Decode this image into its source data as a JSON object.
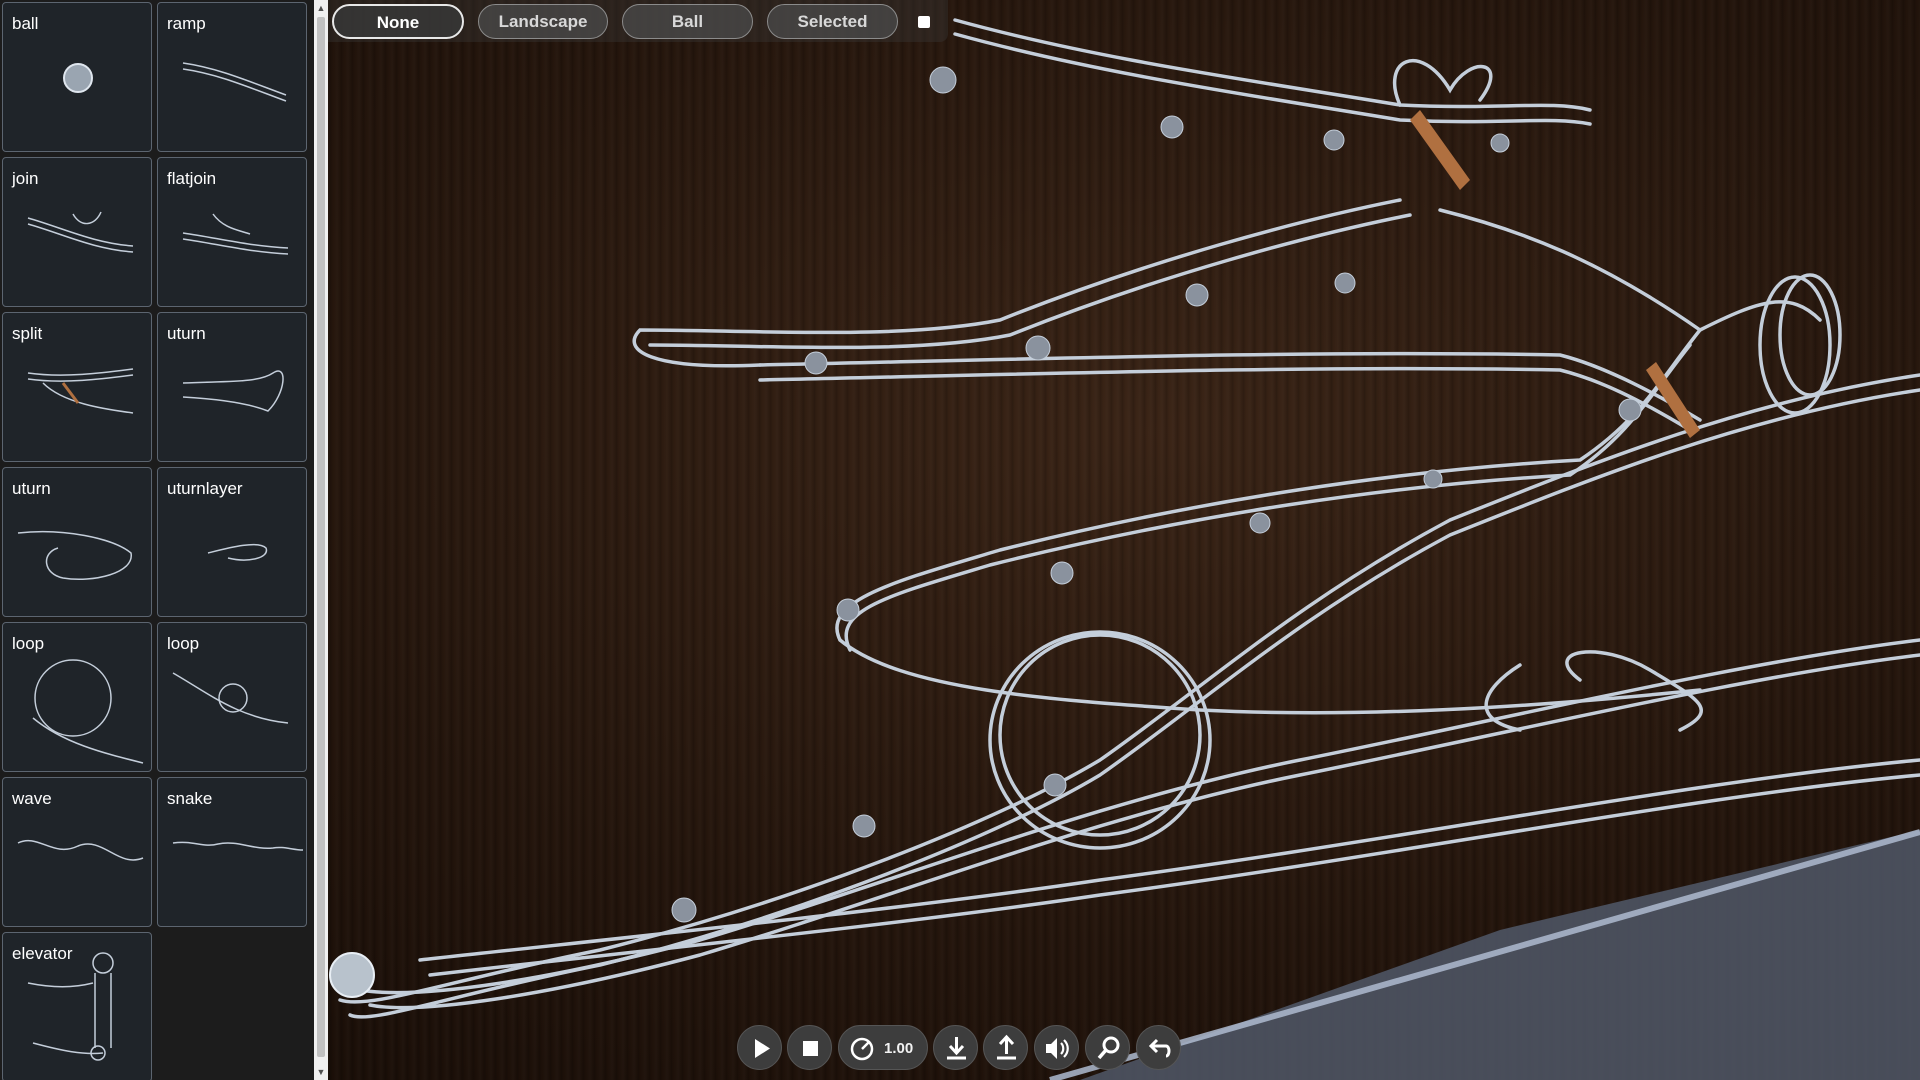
{
  "palette": {
    "tiles": [
      {
        "label": "ball"
      },
      {
        "label": "ramp"
      },
      {
        "label": "join"
      },
      {
        "label": "flatjoin"
      },
      {
        "label": "split"
      },
      {
        "label": "uturn"
      },
      {
        "label": "uturn"
      },
      {
        "label": "uturnlayer"
      },
      {
        "label": "loop"
      },
      {
        "label": "loop"
      },
      {
        "label": "wave"
      },
      {
        "label": "snake"
      },
      {
        "label": "elevator"
      }
    ]
  },
  "camera_modes": {
    "none": "None",
    "landscape": "Landscape",
    "ball": "Ball",
    "selected": "Selected",
    "active": "None"
  },
  "toolbar": {
    "play_icon": "play-icon",
    "stop_icon": "stop-icon",
    "speed_icon": "speedometer-icon",
    "speed_value": "1.00",
    "download_icon": "download-icon",
    "upload_icon": "upload-icon",
    "sound_icon": "speaker-icon",
    "zoom_icon": "magnifier-icon",
    "undo_icon": "undo-icon"
  },
  "colors": {
    "track": "#c9d3de",
    "wall": "#2a1a0f",
    "floor": "#5a6070",
    "toolbar": "#3d3d3d"
  }
}
